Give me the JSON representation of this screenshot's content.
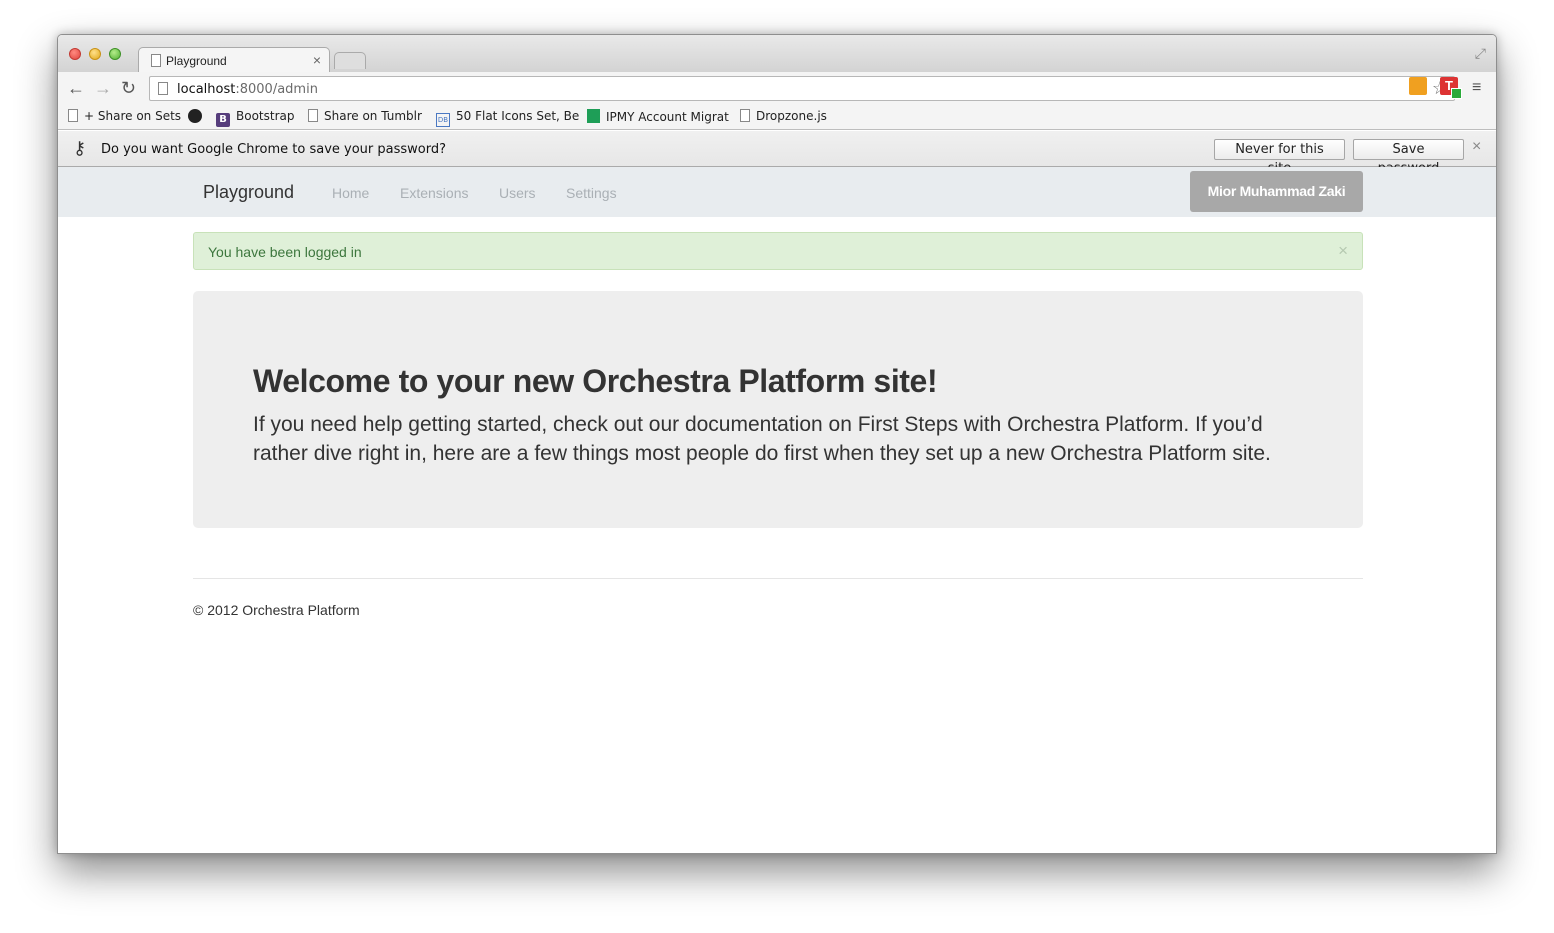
{
  "browser": {
    "tab": {
      "title": "Playground",
      "close": "×"
    },
    "url": {
      "host": "localhost",
      "path": ":8000/admin"
    },
    "nav": {
      "back": "←",
      "forward": "→",
      "reload": "↻",
      "star": "☆",
      "menu": "≡",
      "fullscreen": "⤢"
    },
    "extensions": {
      "t_label": "T"
    }
  },
  "bookmarks": [
    {
      "label": "+ Share on Sets",
      "icon": "page-icon"
    },
    {
      "label": "",
      "icon": "github-icon"
    },
    {
      "label": "Bootstrap",
      "icon": "bootstrap-icon",
      "icon_text": "B"
    },
    {
      "label": "Share on Tumblr",
      "icon": "page-icon"
    },
    {
      "label": "50 Flat Icons Set, Be",
      "icon": "db-icon",
      "icon_text": "DB"
    },
    {
      "label": "IPMY Account Migrat",
      "icon": "sheet-icon"
    },
    {
      "label": "Dropzone.js",
      "icon": "page-icon"
    }
  ],
  "password_bar": {
    "message": "Do you want Google Chrome to save your password?",
    "never_label": "Never for this site",
    "save_label": "Save password",
    "close": "×"
  },
  "site": {
    "brand": "Playground",
    "nav": [
      "Home",
      "Extensions",
      "Users",
      "Settings"
    ],
    "user": "Mior Muhammad Zaki"
  },
  "alert": {
    "text": "You have been logged in",
    "close": "×"
  },
  "jumbotron": {
    "heading": "Welcome to your new Orchestra Platform site!",
    "body": "If you need help getting started, check out our documentation on First Steps with Orchestra Platform. If you’d rather dive right in, here are a few things most people do first when they set up a new Orchestra Platform site."
  },
  "footer": {
    "text": "© 2012 Orchestra Platform"
  }
}
